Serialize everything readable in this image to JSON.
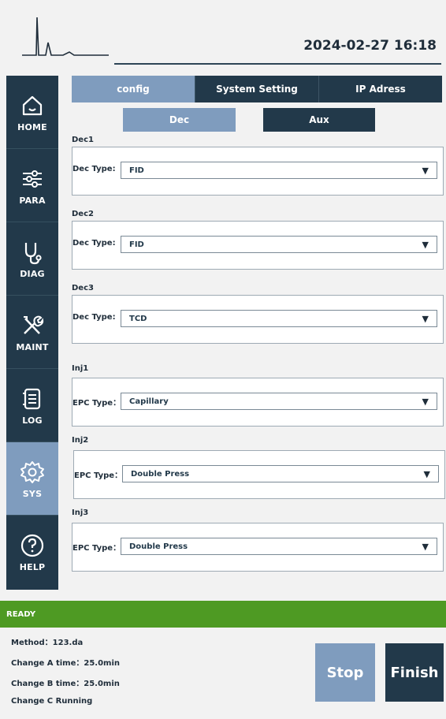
{
  "header": {
    "datetime": "2024-02-27  16:18"
  },
  "sidebar": {
    "items": [
      {
        "label": "HOME",
        "icon": "home-icon"
      },
      {
        "label": "PARA",
        "icon": "sliders-icon"
      },
      {
        "label": "DIAG",
        "icon": "stethoscope-icon"
      },
      {
        "label": "MAINT",
        "icon": "tools-icon"
      },
      {
        "label": "LOG",
        "icon": "log-icon"
      },
      {
        "label": "SYS",
        "icon": "gear-icon",
        "active": true
      },
      {
        "label": "HELP",
        "icon": "help-icon"
      }
    ]
  },
  "tabs": [
    {
      "label": "config",
      "active": true
    },
    {
      "label": "System Setting"
    },
    {
      "label": "IP Adress"
    }
  ],
  "subtabs": {
    "dec": "Dec",
    "aux": "Aux"
  },
  "groups": [
    {
      "title": "Dec1",
      "label": "Dec Type:",
      "value": "FID"
    },
    {
      "title": "Dec2",
      "label": "Dec Type:",
      "value": "FID"
    },
    {
      "title": "Dec3",
      "label": "Dec Type:",
      "value": "TCD"
    },
    {
      "title": "Inj1",
      "label": "EPC Type：",
      "value": "Capillary"
    },
    {
      "title": "Inj2",
      "label": "EPC Type：",
      "value": "Double Press"
    },
    {
      "title": "Inj3",
      "label": "EPC Type：",
      "value": "Double Press"
    }
  ],
  "select_arrow": "▼",
  "status": {
    "text": "READY",
    "method": "Method：123.da",
    "change_a": "Change A time：25.0min",
    "change_b": "Change B time：25.0min",
    "change_c": "Change C Running"
  },
  "buttons": {
    "stop": "Stop",
    "finish": "Finish"
  },
  "colors": {
    "navy": "#22394a",
    "active_blue": "#7f9cbe",
    "ready_green": "#4e9a23",
    "background": "#f2f2f2"
  }
}
